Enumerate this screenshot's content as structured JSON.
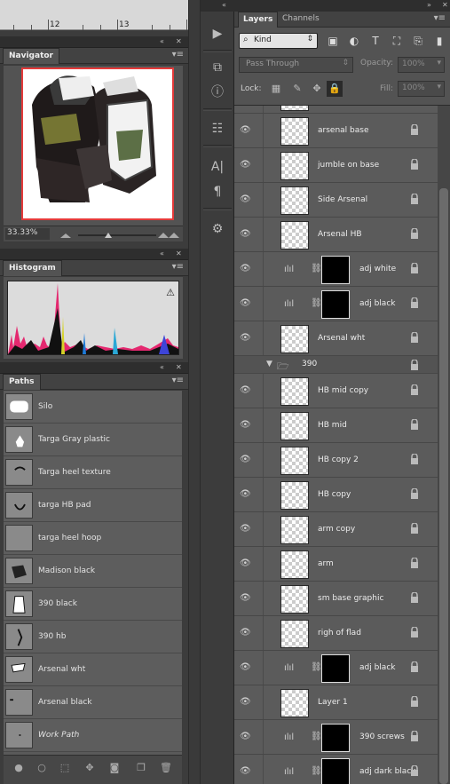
{
  "ruler": {
    "marks": [
      "12",
      "13"
    ]
  },
  "panels": {
    "navigator": {
      "tab": "Navigator",
      "zoom": "33.33%"
    },
    "histogram": {
      "tab": "Histogram",
      "warning_icon": "warning-icon"
    },
    "paths": {
      "tab": "Paths",
      "items": [
        {
          "label": "Silo"
        },
        {
          "label": "Targa Gray plastic"
        },
        {
          "label": "Targa heel texture"
        },
        {
          "label": "targa HB pad"
        },
        {
          "label": "targa heel hoop"
        },
        {
          "label": "Madison black"
        },
        {
          "label": "390 black"
        },
        {
          "label": "390 hb"
        },
        {
          "label": "Arsenal wht"
        },
        {
          "label": "Arsenal black"
        },
        {
          "label": "Work Path"
        }
      ]
    }
  },
  "layers_panel": {
    "tabs": [
      "Layers",
      "Channels"
    ],
    "filter_kind": "Kind",
    "blend_mode": "Pass Through",
    "opacity_label": "Opacity:",
    "opacity_value": "100%",
    "lock_label": "Lock:",
    "fill_label": "Fill:",
    "fill_value": "100%",
    "layers": [
      {
        "name": "arsenal base",
        "kind": "pixel"
      },
      {
        "name": "jumble on base",
        "kind": "pixel"
      },
      {
        "name": "Side Arsenal",
        "kind": "pixel"
      },
      {
        "name": "Arsenal HB",
        "kind": "pixel"
      },
      {
        "name": "adj white",
        "kind": "adjustment"
      },
      {
        "name": "adj black",
        "kind": "adjustment"
      },
      {
        "name": "Arsenal wht",
        "kind": "pixel"
      },
      {
        "name": "390",
        "kind": "group"
      },
      {
        "name": "HB mid copy",
        "kind": "pixel"
      },
      {
        "name": "HB mid",
        "kind": "pixel"
      },
      {
        "name": "HB copy 2",
        "kind": "pixel"
      },
      {
        "name": "HB copy",
        "kind": "pixel"
      },
      {
        "name": "arm copy",
        "kind": "pixel"
      },
      {
        "name": "arm",
        "kind": "pixel"
      },
      {
        "name": "sm base graphic",
        "kind": "pixel"
      },
      {
        "name": "righ of flad",
        "kind": "pixel"
      },
      {
        "name": "adj black",
        "kind": "adjustment"
      },
      {
        "name": "Layer 1",
        "kind": "pixel"
      },
      {
        "name": "390 screws",
        "kind": "adjustment"
      },
      {
        "name": "adj dark black",
        "kind": "adjustment"
      }
    ]
  },
  "colors": {
    "accent": "#e43a3a",
    "panel_bg": "#535353",
    "dark_bg": "#3c3c3c"
  }
}
